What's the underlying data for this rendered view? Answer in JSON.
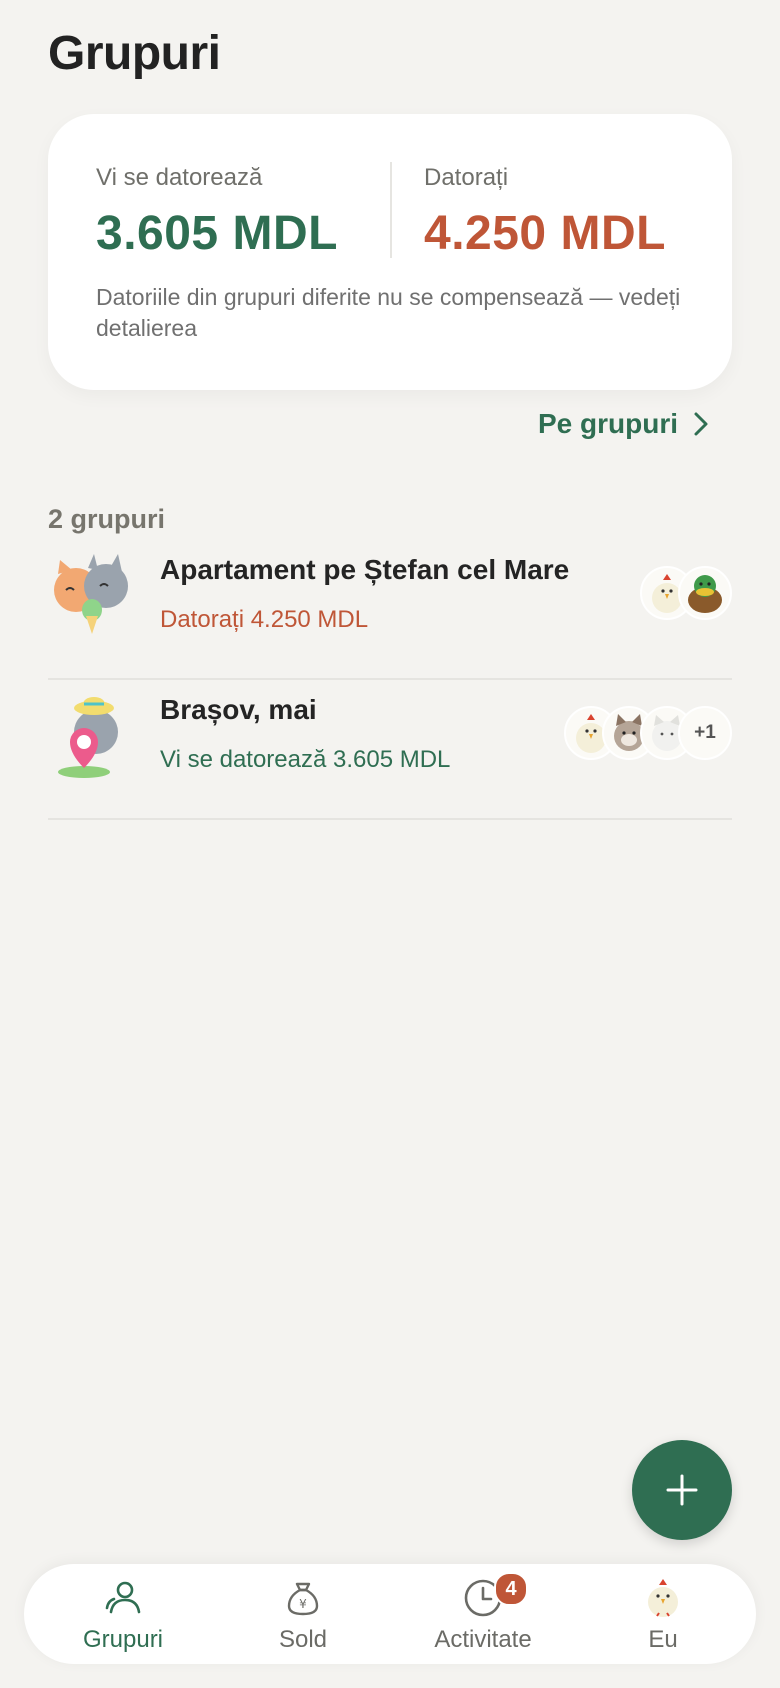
{
  "header": {
    "title": "Grupuri"
  },
  "summary": {
    "owed_to_you_label": "Vi se datorează",
    "owed_to_you_amount": "3.605 MDL",
    "you_owe_label": "Datorați",
    "you_owe_amount": "4.250 MDL",
    "note": "Datoriile din grupuri diferite nu se compensează — vedeți detalierea",
    "colors": {
      "positive": "#2f6e52",
      "negative": "#bf5637"
    }
  },
  "by_groups_link": {
    "label": "Pe grupuri",
    "icon": "chevron-right-icon"
  },
  "groups_section": {
    "count_label": "2 grupuri",
    "groups": [
      {
        "name": "Apartament pe Ștefan cel Mare",
        "status": "Datorați 4.250 MDL",
        "status_type": "negative",
        "avatar_icon": "cats-hug-sticker-icon",
        "member_icons": [
          "chicken-icon",
          "duck-icon"
        ]
      },
      {
        "name": "Brașov, mai",
        "status": "Vi se datorează 3.605 MDL",
        "status_type": "positive",
        "avatar_icon": "cat-travel-pin-sticker-icon",
        "member_icons": [
          "chicken-icon",
          "cat-icon",
          "cat-white-icon"
        ],
        "more_members": "+1"
      }
    ]
  },
  "fab": {
    "icon": "plus-icon"
  },
  "tabbar": {
    "tabs": [
      {
        "label": "Grupuri",
        "icon": "people-icon",
        "active": true
      },
      {
        "label": "Sold",
        "icon": "money-bag-icon"
      },
      {
        "label": "Activitate",
        "icon": "clock-icon",
        "badge": "4"
      },
      {
        "label": "Eu",
        "icon": "chicken-avatar-icon"
      }
    ]
  }
}
